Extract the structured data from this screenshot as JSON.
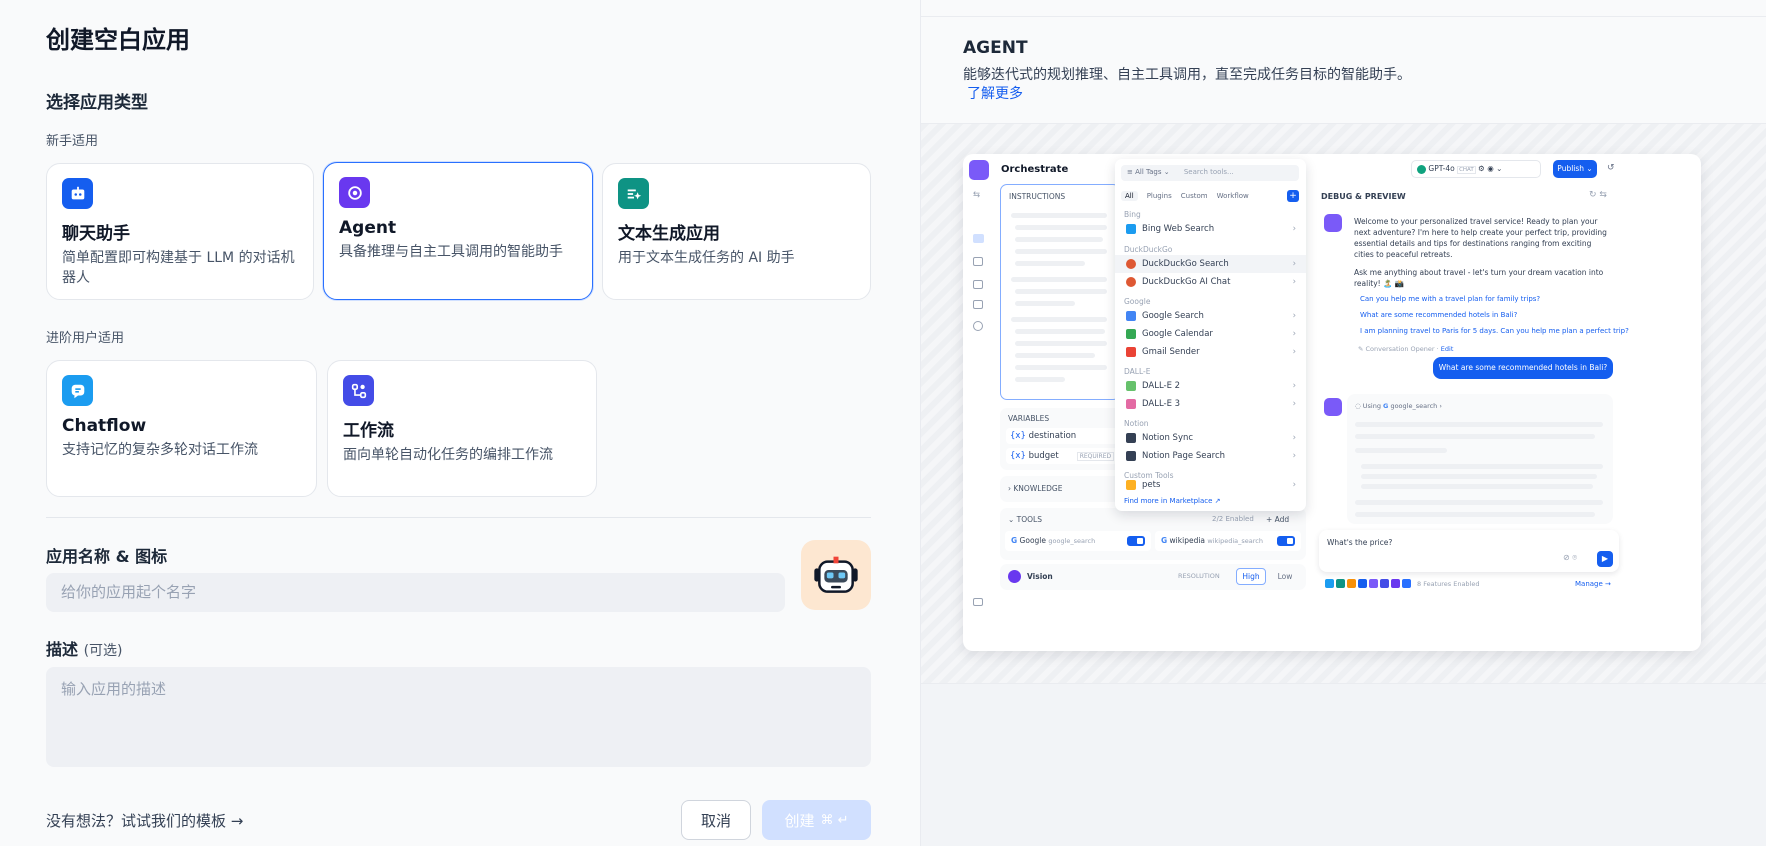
{
  "page_title": "创建空白应用",
  "app_type_section": "选择应用类型",
  "beginner_label": "新手适用",
  "advanced_label": "进阶用户适用",
  "cards": [
    {
      "title": "聊天助手",
      "desc": "简单配置即可构建基于 LLM 的对话机器人",
      "color": "#155eef",
      "icon": "chat-bot-icon"
    },
    {
      "title": "Agent",
      "desc": "具备推理与自主工具调用的智能助手",
      "color": "#6938ef",
      "icon": "agent-icon",
      "selected": true
    },
    {
      "title": "文本生成应用",
      "desc": "用于文本生成任务的 AI 助手",
      "color": "#0e9384",
      "icon": "text-generation-icon"
    },
    {
      "title": "Chatflow",
      "desc": "支持记忆的复杂多轮对话工作流",
      "color": "#1b9cf0",
      "icon": "chatflow-icon"
    },
    {
      "title": "工作流",
      "desc": "面向单轮自动化任务的编排工作流",
      "color": "#444ce7",
      "icon": "workflow-icon"
    }
  ],
  "name_label": "应用名称 & 图标",
  "name_placeholder": "给你的应用起个名字",
  "desc_label": "描述",
  "desc_optional": "(可选)",
  "desc_placeholder": "输入应用的描述",
  "template_link": "没有想法？试试我们的模板 →",
  "cancel_label": "取消",
  "create_label": "创建",
  "create_shortcut": "⌘ ↵",
  "agent_info": {
    "title": "AGENT",
    "description": "能够迭代式的规划推理、自主工具调用，直至完成任务目标的智能助手。",
    "learn_more": "了解更多"
  },
  "preview": {
    "orchestrate": "Orchestrate",
    "instructions": "INSTRUCTIONS",
    "all_tags": "All Tags",
    "search_tools": "Search tools...",
    "tabs": [
      "All",
      "Plugins",
      "Custom",
      "Workflow"
    ],
    "tool_groups": [
      {
        "group": "Bing",
        "items": [
          "Bing Web Search"
        ]
      },
      {
        "group": "DuckDuckGo",
        "items": [
          "DuckDuckGo Search",
          "DuckDuckGo AI Chat"
        ]
      },
      {
        "group": "Google",
        "items": [
          "Google Search",
          "Google Calendar",
          "Gmail Sender"
        ]
      },
      {
        "group": "DALL-E",
        "items": [
          "DALL-E 2",
          "DALL-E 3"
        ]
      },
      {
        "group": "Notion",
        "items": [
          "Notion Sync",
          "Notion Page Search"
        ]
      },
      {
        "group": "Custom Tools",
        "items": [
          "pets"
        ]
      }
    ],
    "find_more": "Find more in",
    "marketplace": "Marketplace ↗",
    "variables": "VARIABLES",
    "var_destination": "destination",
    "var_budget": "budget",
    "required": "REQUIRED",
    "knowledge": "KNOWLEDGE",
    "tools": "TOOLS",
    "tools_enabled": "2/2 Enabled",
    "add": "+ Add",
    "tool_google": "Google",
    "tool_google_sub": "google_search",
    "tool_wiki": "wikipedia",
    "tool_wiki_sub": "wikipedia_search",
    "vision": "Vision",
    "resolution": "RESOLUTION",
    "high": "High",
    "low": "Low",
    "model": "GPT-4o",
    "model_badge": "CHAT",
    "publish": "Publish",
    "debug_preview": "DEBUG & PREVIEW",
    "welcome": "Welcome to your personalized travel service! Ready to plan your next adventure? I'm here to help create your perfect trip, providing essential details and tips for destinations ranging from exciting cities to peaceful retreats.",
    "ask_me": "Ask me anything about travel - let's turn your dream vacation into reality! 🏝️ 📸",
    "suggestions": [
      "Can you help me with a travel plan for family trips?",
      "What are some recommended hotels in Bali?",
      "I am planning travel to Paris for 5 days. Can you help me plan a perfect trip?"
    ],
    "conversation_opener": "Conversation Opener",
    "edit": "Edit",
    "user_message": "What are some recommended hotels in Bali?",
    "using": "Using",
    "using_tool": "google_search",
    "chat_input": "What's the price?",
    "features_enabled": "8 Features Enabled",
    "manage": "Manage"
  }
}
